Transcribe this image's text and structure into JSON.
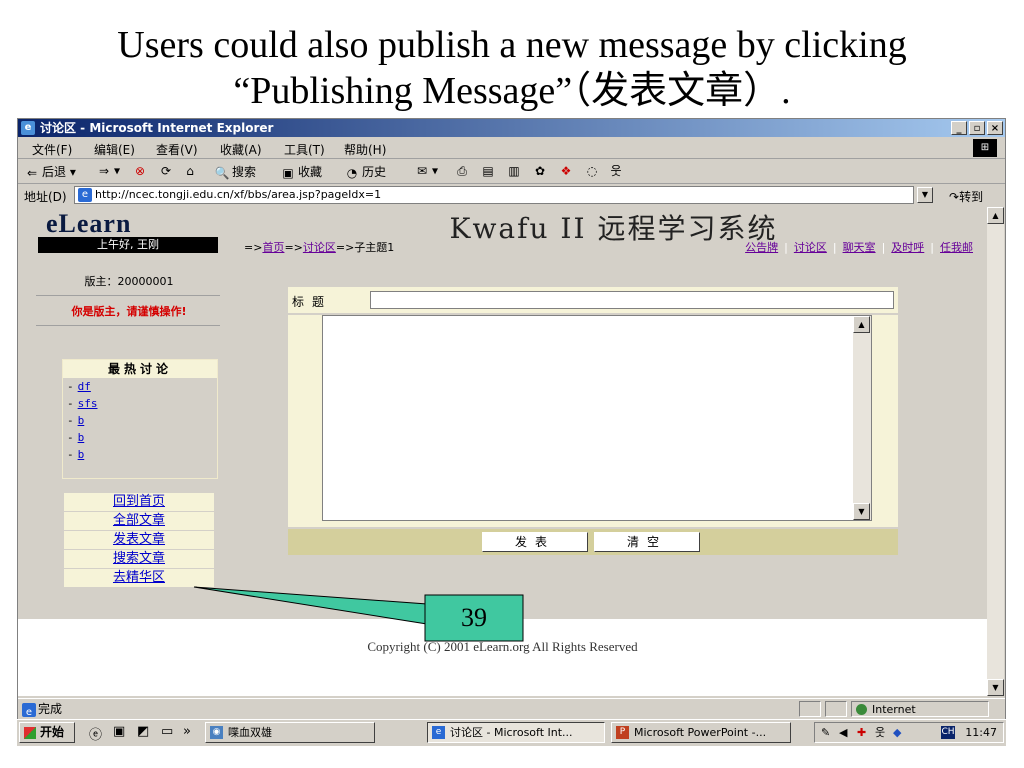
{
  "slide": {
    "line1": "Users could also publish a new message by clicking",
    "line2": "“Publishing Message”（发表文章）."
  },
  "window": {
    "title": "讨论区 - Microsoft Internet Explorer",
    "buttons": [
      "_",
      "▫",
      "×"
    ]
  },
  "menu": [
    "文件(F)",
    "编辑(E)",
    "查看(V)",
    "收藏(A)",
    "工具(T)",
    "帮助(H)"
  ],
  "toolbar": {
    "back": "后退",
    "search": "搜索",
    "favorites": "收藏",
    "history": "历史"
  },
  "address": {
    "label": "地址(D)",
    "url": "http://ncec.tongji.edu.cn/xf/bbs/area.jsp?pageIdx=1",
    "go": "转到"
  },
  "sidebar": {
    "logo": "eLearn",
    "greeting": "上午好, 王刚",
    "moderator": "版主：20000001",
    "warning": "你是版主，请谨慎操作!",
    "hot_title": "最热讨论",
    "hot_items": [
      "df",
      "sfs",
      "b",
      "b",
      "b"
    ],
    "nav": [
      "回到首页",
      "全部文章",
      "发表文章",
      "搜索文章",
      "去精华区"
    ]
  },
  "main": {
    "site_title": "Kwafu II 远程学习系统",
    "crumbs": {
      "prefix": "=>",
      "home": "首页",
      "arrow": "=>",
      "forum": "讨论区",
      "tail": "=>子主题1"
    },
    "toplinks": [
      "公告牌",
      "讨论区",
      "聊天室",
      "及时呼",
      "任我邮"
    ],
    "form": {
      "title_label": "标题",
      "title_value": "",
      "body_value": "",
      "publish": "发表",
      "clear": "清空"
    },
    "copyright": "Copyright (C) 2001 eLearn.org All Rights Reserved"
  },
  "status": {
    "text": "完成",
    "zone": "Internet"
  },
  "taskbar": {
    "start": "开始",
    "tasks": [
      "喋血双雄",
      "讨论区 - Microsoft Int...",
      "Microsoft PowerPoint -..."
    ],
    "clock": "11:47",
    "ime": "CH"
  },
  "callout": {
    "number": "39",
    "color": "#40c8a0"
  }
}
